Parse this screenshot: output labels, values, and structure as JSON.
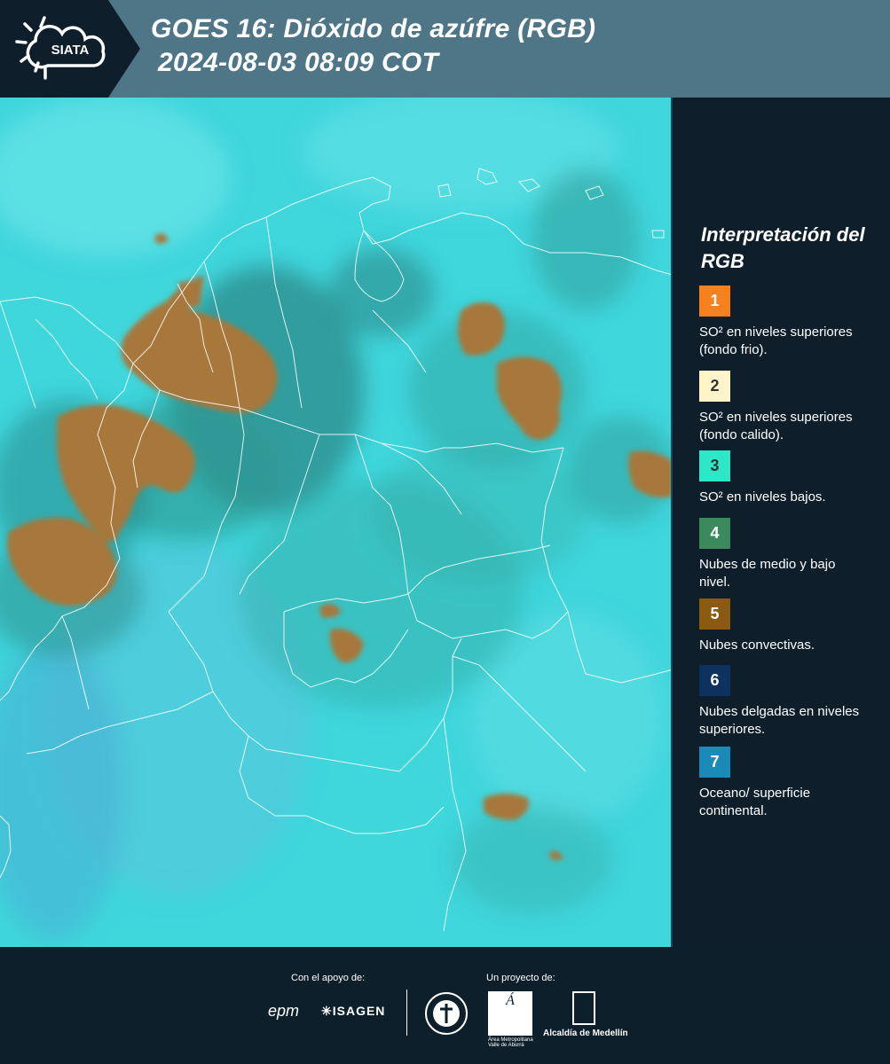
{
  "header": {
    "logo_text": "SIATA",
    "title_line1": "GOES 16: Dióxido de azúfre (RGB)",
    "title_line2": "2024-08-03 08:09 COT"
  },
  "legend": {
    "title": "Interpretación del RGB",
    "items": [
      {
        "number": "1",
        "label": "SO² en niveles superiores (fondo frio).",
        "color": "#f5821f",
        "text_color": "#ffffff"
      },
      {
        "number": "2",
        "label": "SO² en niveles superiores (fondo calido).",
        "color": "#fff5c8",
        "text_color": "#333333"
      },
      {
        "number": "3",
        "label": "SO² en niveles bajos.",
        "color": "#2ee6c8",
        "text_color": "#333333"
      },
      {
        "number": "4",
        "label": "Nubes de medio y bajo nivel.",
        "color": "#3a8a5e",
        "text_color": "#ffffff"
      },
      {
        "number": "5",
        "label": "Nubes convectivas.",
        "color": "#8a5a12",
        "text_color": "#ffffff"
      },
      {
        "number": "6",
        "label": "Nubes delgadas en niveles superiores.",
        "color": "#0d3260",
        "text_color": "#ffffff"
      },
      {
        "number": "7",
        "label": "Oceano/ superficie continental.",
        "color": "#1a8ab8",
        "text_color": "#ffffff"
      }
    ]
  },
  "footer": {
    "support_caption": "Con el apoyo de:",
    "project_caption": "Un proyecto de:",
    "sponsor1": "epm",
    "sponsor2": "ISAGEN",
    "partner1": "Área Metropolitana Valle de Aburrá",
    "partner2": "Alcaldía de Medellín"
  },
  "colors": {
    "map_background": "#3fd6dc",
    "convective_cloud": "#a7773a",
    "header_bg": "#4f7687",
    "panel_bg": "#0e1f2b"
  }
}
